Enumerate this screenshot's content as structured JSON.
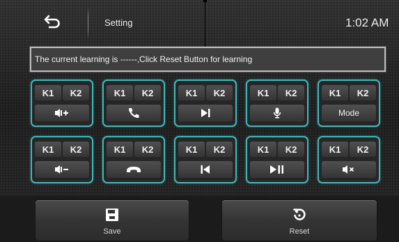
{
  "topbar": {
    "back_icon": "back-arrow-icon",
    "title": "Setting",
    "time": "1:02  AM"
  },
  "status": {
    "message": "The current learning is ------,Click Reset Button for learning"
  },
  "key_cards": [
    {
      "k1": "K1",
      "k2": "K2",
      "function_icon": "volume-up-icon",
      "function_label": ""
    },
    {
      "k1": "K1",
      "k2": "K2",
      "function_icon": "phone-answer-icon",
      "function_label": ""
    },
    {
      "k1": "K1",
      "k2": "K2",
      "function_icon": "next-track-icon",
      "function_label": ""
    },
    {
      "k1": "K1",
      "k2": "K2",
      "function_icon": "microphone-icon",
      "function_label": ""
    },
    {
      "k1": "K1",
      "k2": "K2",
      "function_icon": "",
      "function_label": "Mode"
    },
    {
      "k1": "K1",
      "k2": "K2",
      "function_icon": "volume-down-icon",
      "function_label": ""
    },
    {
      "k1": "K1",
      "k2": "K2",
      "function_icon": "phone-hangup-icon",
      "function_label": ""
    },
    {
      "k1": "K1",
      "k2": "K2",
      "function_icon": "previous-track-icon",
      "function_label": ""
    },
    {
      "k1": "K1",
      "k2": "K2",
      "function_icon": "play-pause-icon",
      "function_label": ""
    },
    {
      "k1": "K1",
      "k2": "K2",
      "function_icon": "mute-icon",
      "function_label": ""
    }
  ],
  "bottom": {
    "save_label": "Save",
    "save_icon": "save-icon",
    "reset_label": "Reset",
    "reset_icon": "reset-icon"
  },
  "colors": {
    "accent": "#3fb7b9",
    "background": "#222222",
    "text": "#f2f2f2"
  }
}
